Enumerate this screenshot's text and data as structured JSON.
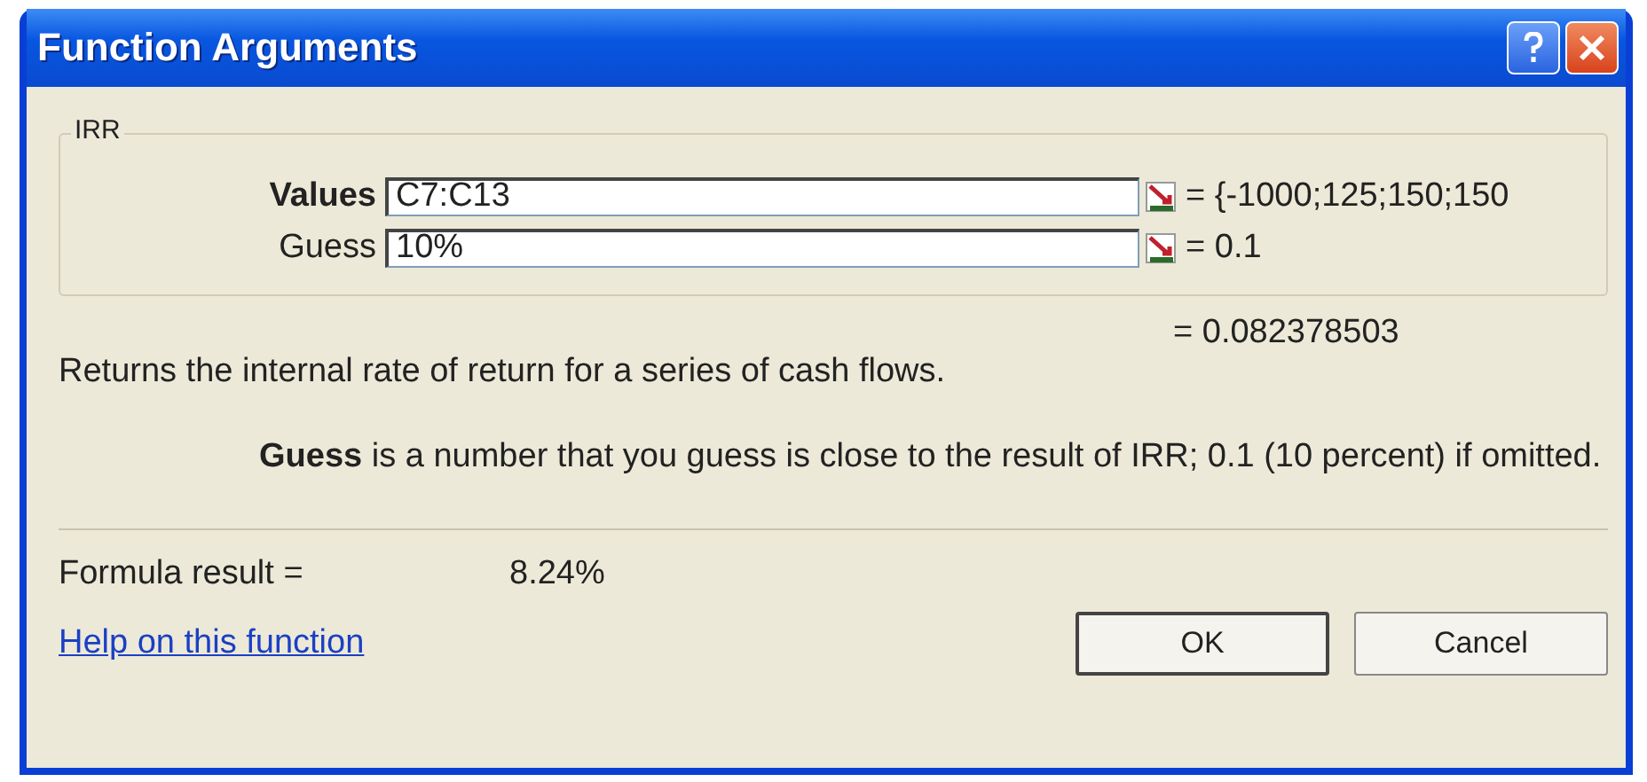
{
  "window": {
    "title": "Function Arguments"
  },
  "function_group": {
    "name": "IRR",
    "arguments": [
      {
        "label": "Values",
        "bold": true,
        "value": "C7:C13",
        "result": "= {-1000;125;150;150"
      },
      {
        "label": "Guess",
        "bold": false,
        "value": "10%",
        "result": "= 0.1"
      }
    ]
  },
  "function_result": "= 0.082378503",
  "description": "Returns the internal rate of return for a series of cash flows.",
  "argument_help": "**Guess** is a number that you guess is close to the result of IRR; 0.1 (10 percent) if omitted.",
  "formula_result": {
    "label": "Formula result =",
    "value": "8.24%"
  },
  "help_link": "Help on this function",
  "buttons": [
    "OK",
    "Cancel"
  ]
}
